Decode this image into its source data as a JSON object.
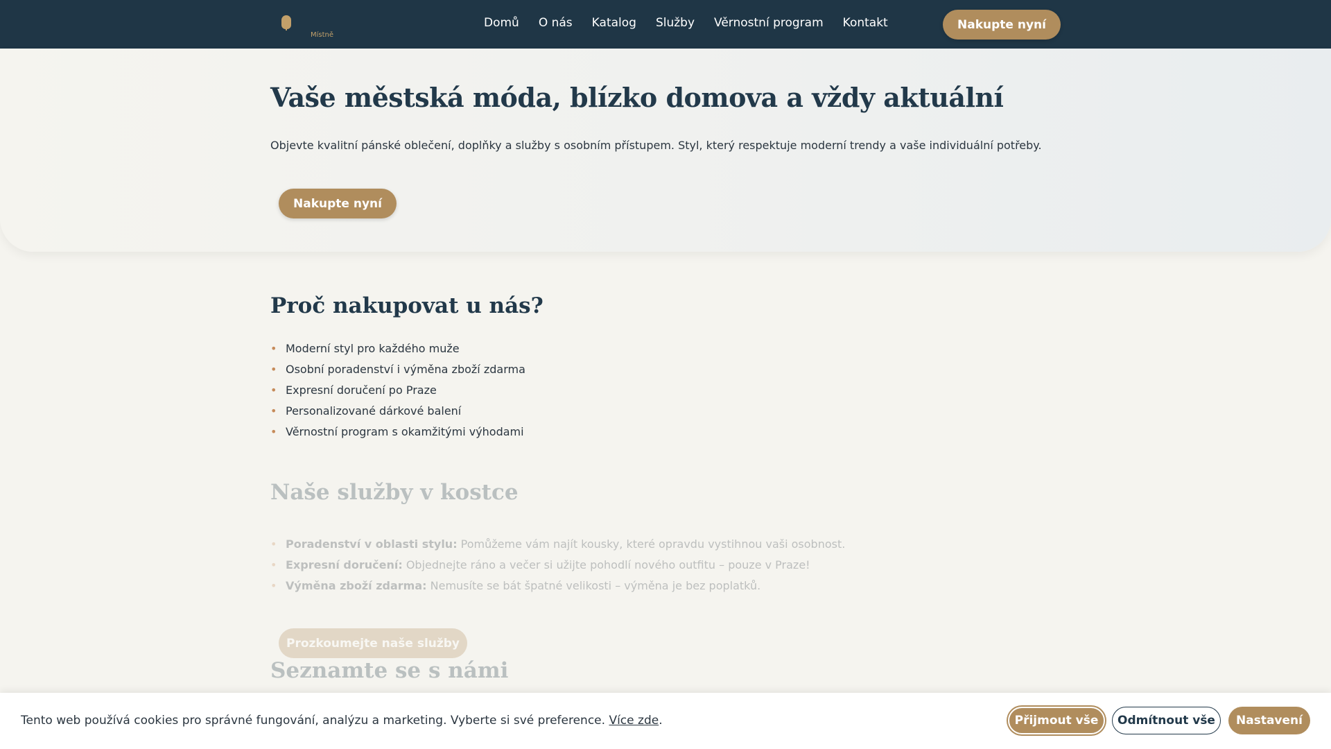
{
  "header": {
    "logo_text": "Místně",
    "nav": [
      "Domů",
      "O nás",
      "Katalog",
      "Služby",
      "Věrnostní program",
      "Kontakt"
    ],
    "cta": "Nakupte nyní"
  },
  "hero": {
    "title": "Vaše městská móda, blízko domova a vždy aktuální",
    "subtitle": "Objevte kvalitní pánské oblečení, doplňky a služby s osobním přístupem. Styl, který respektuje moderní trendy a vaše individuální potřeby.",
    "cta": "Nakupte nyní"
  },
  "why": {
    "title": "Proč nakupovat u nás?",
    "bullet": "•",
    "items": [
      "Moderní styl pro každého muže",
      "Osobní poradenství i výměna zboží zdarma",
      "Expresní doručení po Praze",
      "Personalizované dárkové balení",
      "Věrnostní program s okamžitými výhodami"
    ]
  },
  "services": {
    "title": "Naše služby v kostce",
    "items": [
      {
        "label": "Poradenství v oblasti stylu:",
        "text": " Pomůžeme vám najít kousky, které opravdu vystihnou vaši osobnost."
      },
      {
        "label": "Expresní doručení:",
        "text": " Objednejte ráno a večer si užijte pohodlí nového outfitu – pouze v Praze!"
      },
      {
        "label": "Výměna zboží zdarma:",
        "text": " Nemusíte se bát špatné velikosti – výměna je bez poplatků."
      }
    ],
    "cta": "Prozkoumejte naše služby"
  },
  "meet": {
    "title": "Seznamte se s námi"
  },
  "cookie": {
    "text": "Tento web používá cookies pro správné fungování, analýzu a marketing. Vyberte si své preference. ",
    "link": "Více zde",
    "tail": ".",
    "accept": "Přijmout vše",
    "reject": "Odmítnout vše",
    "settings": "Nastavení"
  }
}
